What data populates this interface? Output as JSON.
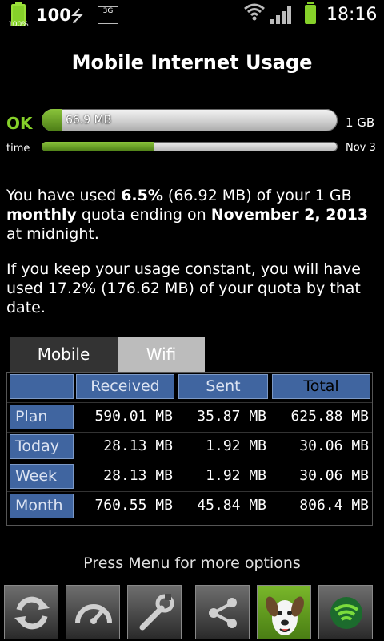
{
  "status_bar": {
    "battery_left_pct_small": "100%",
    "battery_left_pct": "100",
    "network_type": "3G",
    "time": "18:16"
  },
  "title": "Mobile Internet Usage",
  "usage_bar": {
    "status": "OK",
    "used_text": "66.9 MB",
    "cap": "1 GB",
    "fill_fraction": 0.065
  },
  "time_bar": {
    "label": "time",
    "end": "Nov 3",
    "fill_fraction": 0.38
  },
  "summary": {
    "p1_a": "You have used ",
    "p1_pct": "6.5%",
    "p1_b": " (66.92 MB) of your 1 GB ",
    "p1_period": "monthly",
    "p1_c": " quota ending on ",
    "p1_date": "November 2, 2013",
    "p1_d": " at midnight.",
    "p2": "If you keep your usage constant, you will have used 17.2% (176.62 MB) of your quota by that date."
  },
  "tabs": {
    "mobile": "Mobile",
    "wifi": "Wifi"
  },
  "table": {
    "headers": [
      "",
      "Received",
      "Sent",
      "Total"
    ],
    "rows": [
      {
        "label": "Plan",
        "received": "590.01 MB",
        "sent": "35.87 MB",
        "total": "625.88 MB"
      },
      {
        "label": "Today",
        "received": "28.13 MB",
        "sent": "1.92 MB",
        "total": "30.06 MB"
      },
      {
        "label": "Week",
        "received": "28.13 MB",
        "sent": "1.92 MB",
        "total": "30.06 MB"
      },
      {
        "label": "Month",
        "received": "760.55 MB",
        "sent": "45.84 MB",
        "total": "806.4 MB"
      }
    ]
  },
  "menu_hint": "Press Menu for more options",
  "buttons": [
    "refresh-icon",
    "speedometer-icon",
    "wrench-icon",
    "share-icon",
    "dog-icon",
    "security-shield-icon"
  ],
  "colors": {
    "accent_green": "#86d12a",
    "table_header_blue": "#4065a0"
  }
}
